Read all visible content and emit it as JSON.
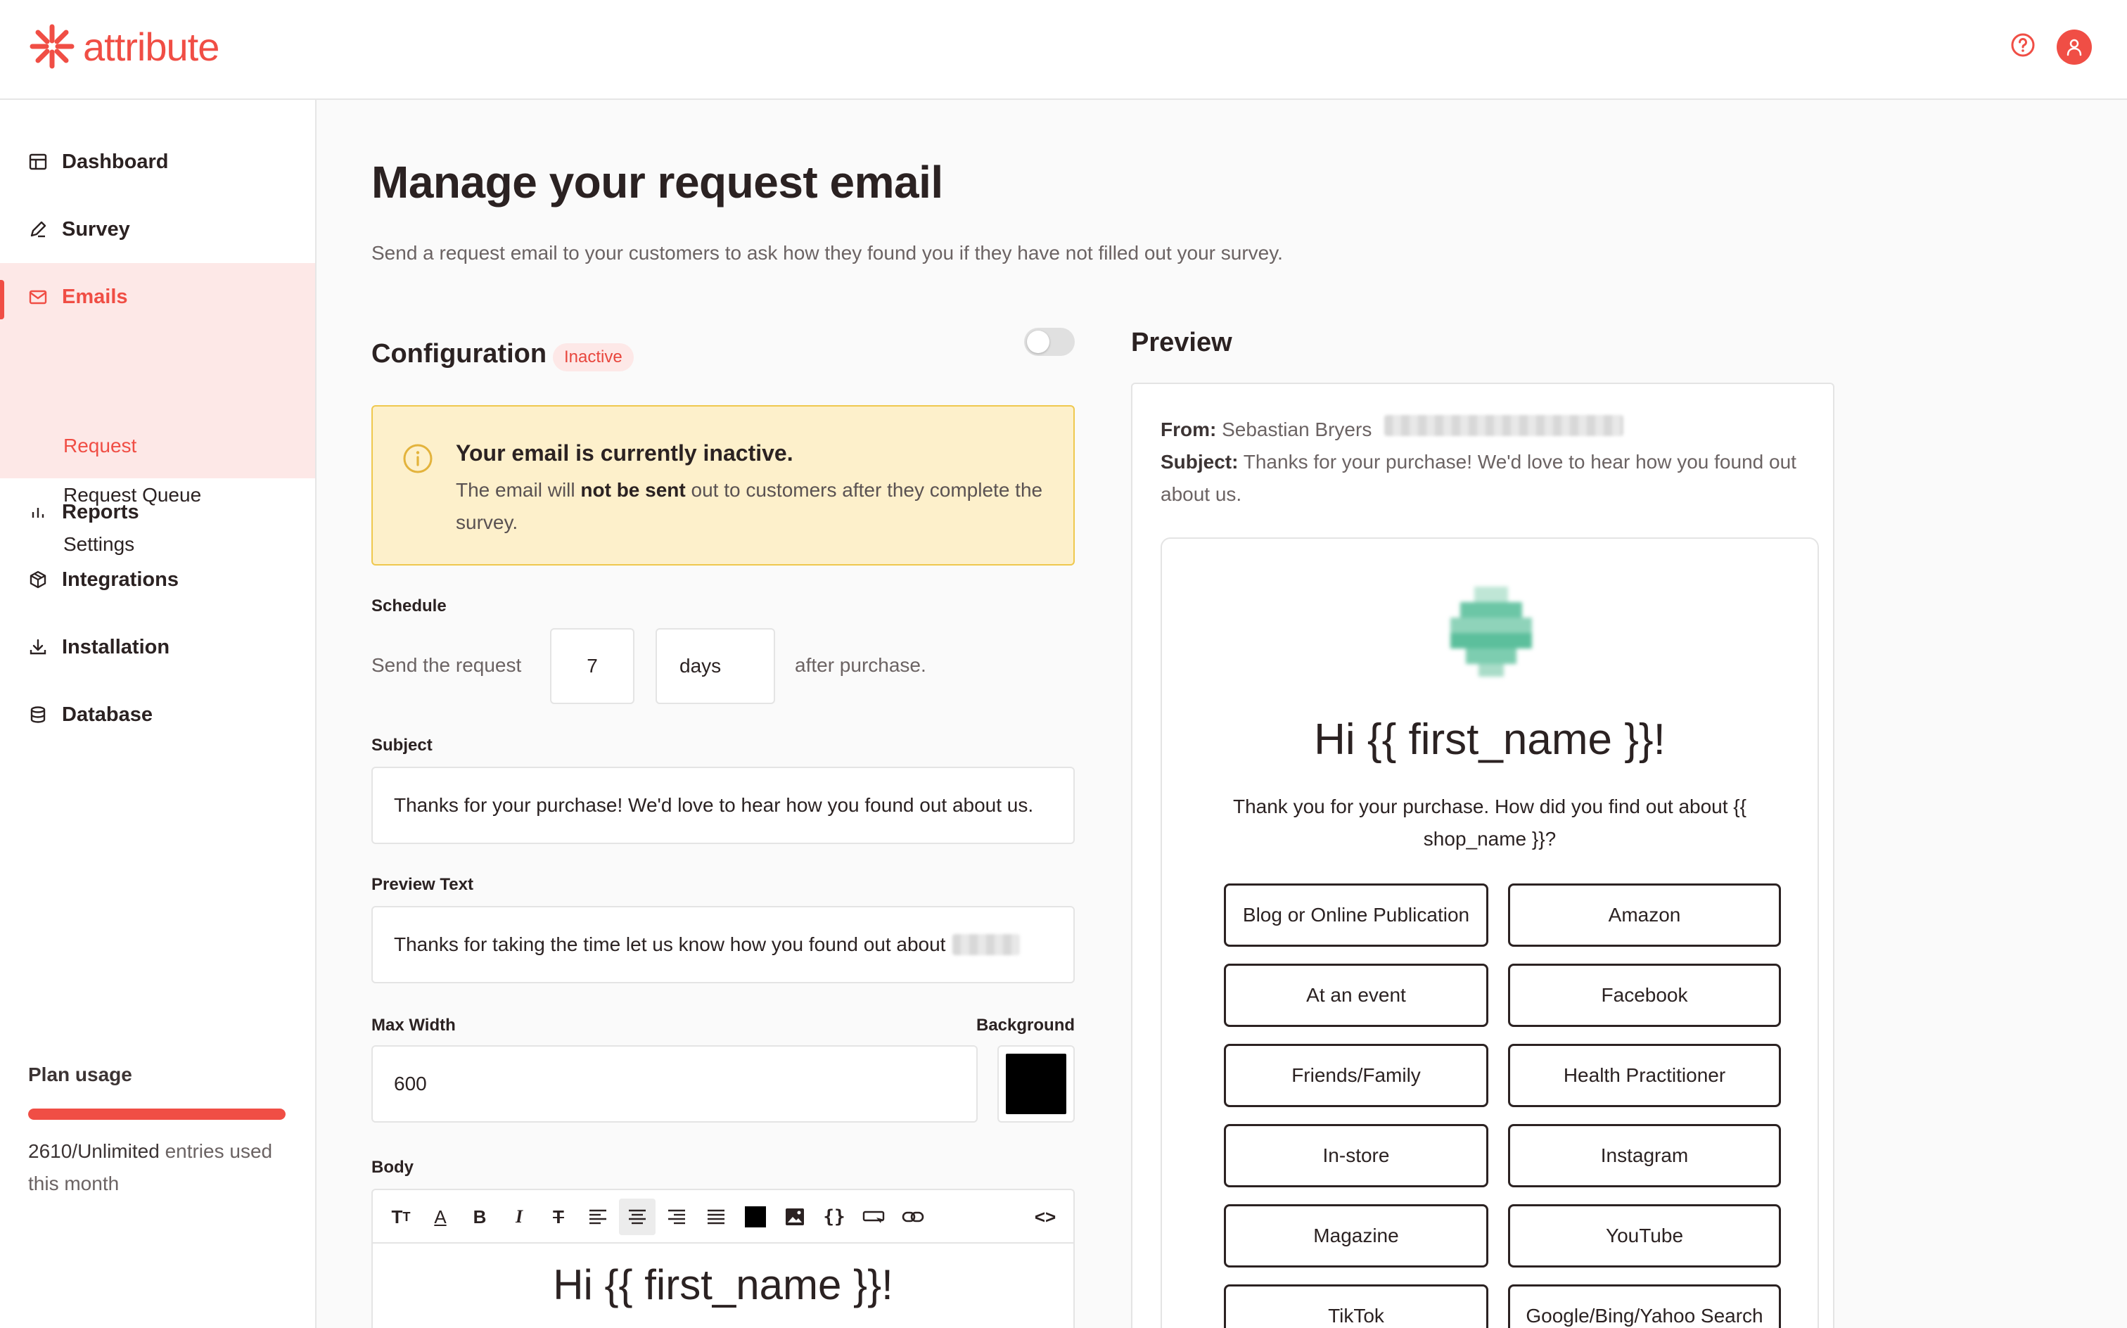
{
  "app": {
    "brand": "attribute",
    "accent": "#f04e45"
  },
  "header": {
    "help_icon": "help-circle-icon",
    "avatar_icon": "user-icon"
  },
  "sidebar": {
    "items": [
      {
        "label": "Dashboard",
        "icon": "layout-icon"
      },
      {
        "label": "Survey",
        "icon": "pencil-icon"
      },
      {
        "label": "Emails",
        "icon": "mail-icon",
        "active": true,
        "children": [
          {
            "label": "Request",
            "active": true
          },
          {
            "label": "Request Queue"
          },
          {
            "label": "Settings"
          }
        ]
      },
      {
        "label": "Reports",
        "icon": "bar-chart-icon"
      },
      {
        "label": "Integrations",
        "icon": "package-icon"
      },
      {
        "label": "Installation",
        "icon": "download-icon"
      },
      {
        "label": "Database",
        "icon": "database-icon"
      }
    ],
    "plan": {
      "title": "Plan usage",
      "used": "2610/Unlimited",
      "suffix": "entries used this month",
      "progress": 1.0
    }
  },
  "main": {
    "title": "Manage your request email",
    "subtitle": "Send a request email to your customers to ask how they found you if they have not filled out your survey.",
    "config": {
      "title": "Configuration",
      "status": "Inactive",
      "enabled": false,
      "alert_title": "Your email is currently inactive.",
      "alert_pre": "The email will ",
      "alert_bold": "not be sent",
      "alert_post": " out to customers after they complete the survey.",
      "schedule_label": "Schedule",
      "schedule_prefix": "Send the request",
      "schedule_value": "7",
      "schedule_unit": "days",
      "schedule_suffix": "after purchase.",
      "subject_label": "Subject",
      "subject_value": "Thanks for your purchase! We'd love to hear how you found out about us.",
      "preview_label": "Preview Text",
      "preview_value": "Thanks for taking the time let us know how you found out about",
      "maxwidth_label": "Max Width",
      "maxwidth_value": "600",
      "background_label": "Background",
      "background_color": "#000000",
      "body_label": "Body",
      "body_heading": "Hi {{ first_name }}!"
    },
    "preview": {
      "title": "Preview",
      "from_label": "From:",
      "from_value": "Sebastian Bryers",
      "subject_label": "Subject:",
      "subject_value": "Thanks for your purchase! We'd love to hear how you found out about us.",
      "heading": "Hi {{ first_name }}!",
      "text": "Thank you for your purchase. How did you find out about {{ shop_name }}?",
      "options": [
        "Blog or Online Publication",
        "Amazon",
        "At an event",
        "Facebook",
        "Friends/Family",
        "Health Practitioner",
        "In-store",
        "Instagram",
        "Magazine",
        "YouTube",
        "TikTok",
        "Google/Bing/Yahoo Search"
      ]
    }
  }
}
